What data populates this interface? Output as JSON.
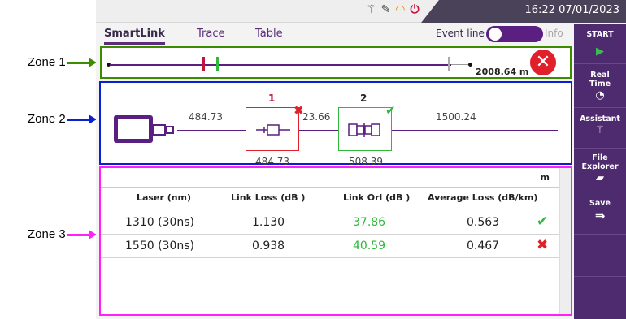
{
  "annotations": {
    "zone1": "Zone 1",
    "zone2": "Zone 2",
    "zone3": "Zone 3",
    "zone1_color": "#3c8c00",
    "zone2_color": "#0a1fcf",
    "zone3_color": "#ff21f5"
  },
  "statusbar": {
    "icons": [
      "magic-wand-icon",
      "probe-icon",
      "wifi-icon",
      "power-icon"
    ],
    "time": "16:22",
    "date": "07/01/2023"
  },
  "tabs": [
    {
      "label": "SmartLink",
      "active": true
    },
    {
      "label": "Trace",
      "active": false
    },
    {
      "label": "Table",
      "active": false
    }
  ],
  "event_line": {
    "label": "Event line",
    "info_label": "Info",
    "on": true
  },
  "zone1": {
    "distance": "2008.64 m",
    "markers": [
      {
        "color": "#c0143c"
      },
      {
        "color": "#2fb83a"
      },
      {
        "color": "#aaaaaa"
      }
    ],
    "close_icon": "close-icon"
  },
  "zone2": {
    "segments": {
      "first": "484.73",
      "middle": "23.66",
      "last": "1500.24"
    },
    "events": [
      {
        "number": "1",
        "position": "484.73",
        "status": "fail",
        "color": "#e0202a",
        "icon": "splitter-icon"
      },
      {
        "number": "2",
        "position": "508.39",
        "status": "pass",
        "color": "#2fb83a",
        "icon": "connector-icon"
      }
    ]
  },
  "zone3": {
    "unit": "m",
    "headers": [
      "Laser (nm)",
      "Link Loss (dB )",
      "Link Orl (dB )",
      "Average Loss (dB/km)"
    ],
    "rows": [
      {
        "laser": "1310 (30ns)",
        "link_loss": "1.130",
        "link_orl": "37.86",
        "avg_loss": "0.563",
        "status": "pass"
      },
      {
        "laser": "1550 (30ns)",
        "link_loss": "0.938",
        "link_orl": "40.59",
        "avg_loss": "0.467",
        "status": "fail"
      }
    ],
    "pass_color": "#2fb83a",
    "fail_color": "#e0202a"
  },
  "sidebar": [
    {
      "label": "START",
      "icon": "play-icon"
    },
    {
      "label": "Real Time",
      "icon": "stopwatch-icon"
    },
    {
      "label": "Assistant",
      "icon": "magic-wand-icon"
    },
    {
      "label": "File Explorer",
      "icon": "folder-icon"
    },
    {
      "label": "Save",
      "icon": "save-icon"
    }
  ]
}
